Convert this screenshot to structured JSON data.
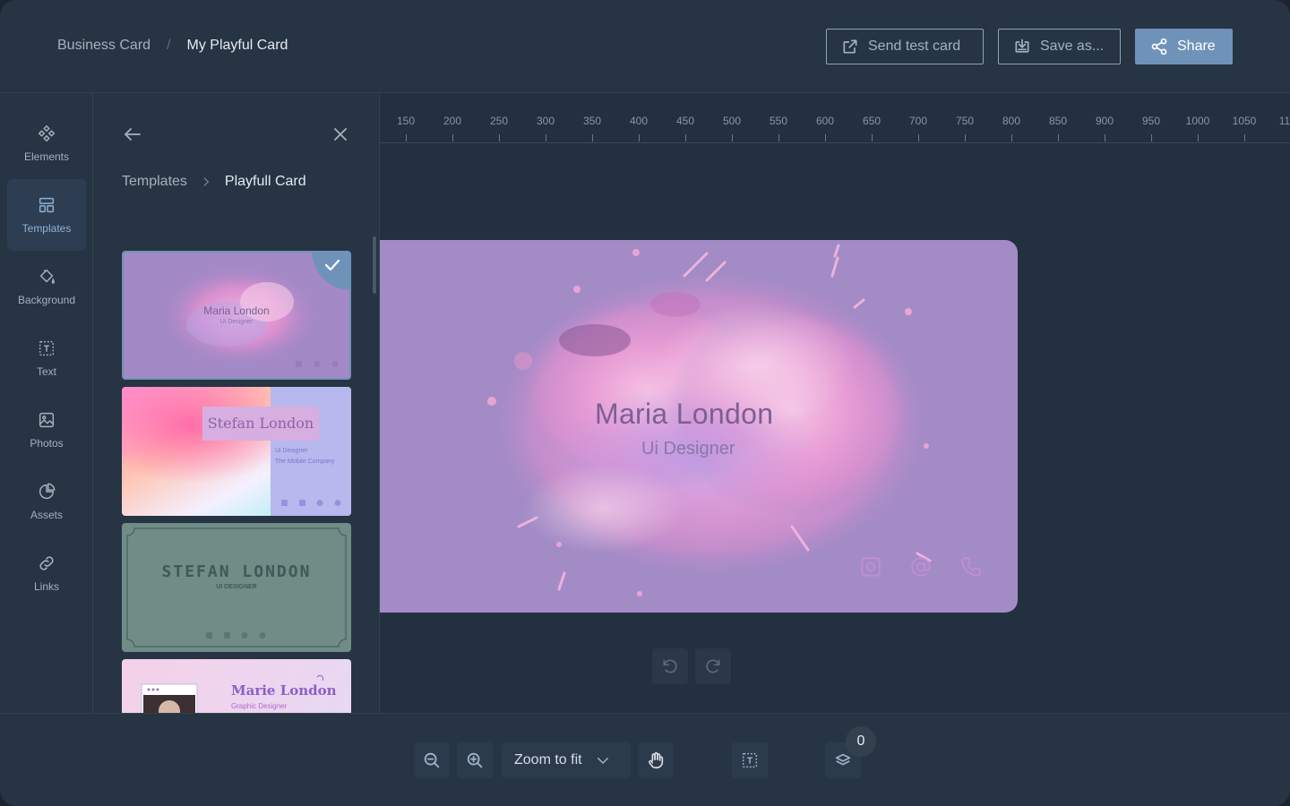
{
  "header": {
    "breadcrumb_root": "Business Card",
    "breadcrumb_sep": "/",
    "breadcrumb_current": "My Playful Card",
    "send_test_label": "Send test card",
    "save_as_label": "Save as...",
    "share_label": "Share"
  },
  "sidebar": {
    "items": [
      {
        "label": "Elements",
        "icon": "elements-icon",
        "active": false
      },
      {
        "label": "Templates",
        "icon": "templates-icon",
        "active": true
      },
      {
        "label": "Background",
        "icon": "paint-bucket-icon",
        "active": false
      },
      {
        "label": "Text",
        "icon": "text-icon",
        "active": false
      },
      {
        "label": "Photos",
        "icon": "image-icon",
        "active": false
      },
      {
        "label": "Assets",
        "icon": "pie-chart-icon",
        "active": false
      },
      {
        "label": "Links",
        "icon": "link-icon",
        "active": false
      }
    ]
  },
  "panel": {
    "crumb_root": "Templates",
    "crumb_current": "Playfull Card",
    "templates": [
      {
        "name": "Maria London",
        "subtitle": "Ui Designer",
        "selected": true
      },
      {
        "name": "Stefan London",
        "subtitle": "Ui Designer",
        "company": "The Mobile Company",
        "selected": false
      },
      {
        "name": "STEFAN LONDON",
        "subtitle": "UI DESIGNER",
        "selected": false
      },
      {
        "name": "Marie London",
        "subtitle": "Graphic Designer",
        "selected": false
      }
    ]
  },
  "ruler": {
    "ticks": [
      "150",
      "200",
      "250",
      "300",
      "350",
      "400",
      "450",
      "500",
      "550",
      "600",
      "650",
      "700",
      "750",
      "800",
      "850",
      "900",
      "950",
      "1000",
      "1050",
      "11"
    ]
  },
  "card": {
    "name": "Maria London",
    "role": "Ui Designer",
    "icons": [
      "instagram-icon",
      "at-icon",
      "phone-icon"
    ]
  },
  "toolbar": {
    "zoom_label": "Zoom to fit",
    "layers_count": "0"
  },
  "colors": {
    "accent": "#6f93b8",
    "card_bg": "#a38bc6",
    "app_bg": "#243140"
  }
}
